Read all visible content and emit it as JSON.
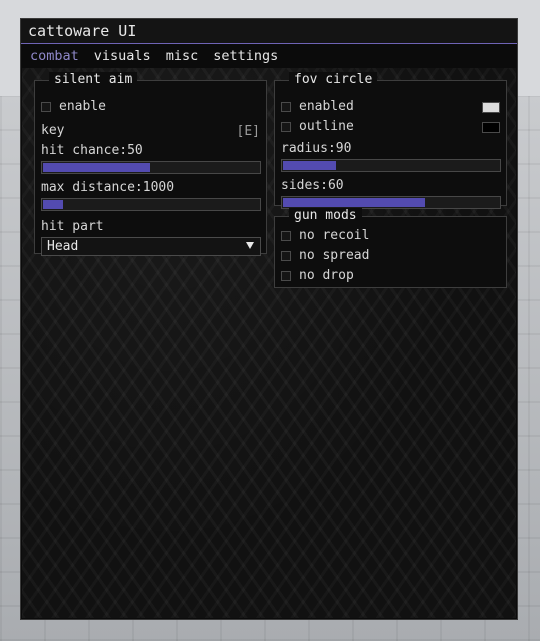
{
  "window": {
    "title": "cattoware UI",
    "accent_color": "#534bb0",
    "tabs": [
      "combat",
      "visuals",
      "misc",
      "settings"
    ],
    "active_tab": "combat"
  },
  "silent_aim": {
    "title": "silent aim",
    "enable_label": "enable",
    "enable_checked": false,
    "key_label": "key",
    "key_value": "[E]",
    "hit_chance_label": "hit chance:",
    "hit_chance_value": "50",
    "hit_chance_fraction": 0.5,
    "max_distance_label": "max distance:",
    "max_distance_value": "1000",
    "max_distance_fraction": 0.1,
    "hit_part_label": "hit part",
    "hit_part_value": "Head"
  },
  "fov_circle": {
    "title": "fov circle",
    "enabled_label": "enabled",
    "enabled_checked": false,
    "enabled_color": "#dcdcdc",
    "outline_label": "outline",
    "outline_checked": false,
    "outline_color": "#000000",
    "radius_label": "radius:",
    "radius_value": "90",
    "radius_fraction": 0.25,
    "sides_label": "sides:",
    "sides_value": "60",
    "sides_fraction": 0.66
  },
  "gun_mods": {
    "title": "gun mods",
    "items": [
      {
        "label": "no recoil",
        "checked": false
      },
      {
        "label": "no spread",
        "checked": false
      },
      {
        "label": "no drop",
        "checked": false
      }
    ]
  }
}
